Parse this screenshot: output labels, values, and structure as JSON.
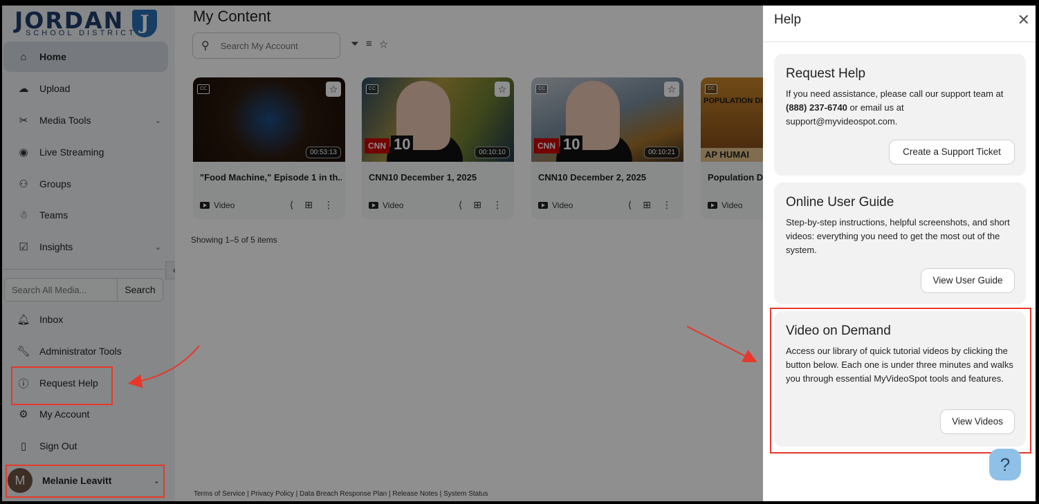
{
  "logo": {
    "wordmark": "JORDAN",
    "subtitle": "SCHOOL DISTRICT",
    "shield_letter": "J"
  },
  "sidebar": {
    "items": [
      {
        "label": "Home",
        "icon": "home-icon",
        "active": true
      },
      {
        "label": "Upload",
        "icon": "upload-icon"
      },
      {
        "label": "Media Tools",
        "icon": "tools-icon",
        "has_chevron": true
      },
      {
        "label": "Live Streaming",
        "icon": "broadcast-icon"
      },
      {
        "label": "Groups",
        "icon": "groups-icon"
      },
      {
        "label": "Teams",
        "icon": "teams-icon"
      },
      {
        "label": "Insights",
        "icon": "insights-icon",
        "has_chevron": true
      }
    ],
    "search_placeholder": "Search All Media...",
    "search_button": "Search",
    "bottom_items": [
      {
        "label": "Inbox",
        "icon": "bell-icon"
      },
      {
        "label": "Administrator Tools",
        "icon": "wrench-icon"
      },
      {
        "label": "Request Help",
        "icon": "info-icon"
      },
      {
        "label": "My Account",
        "icon": "gear-icon"
      },
      {
        "label": "Sign Out",
        "icon": "door-icon"
      }
    ],
    "user": {
      "initial": "M",
      "name": "Melanie Leavitt"
    }
  },
  "main": {
    "title": "My Content",
    "search_placeholder": "Search My Account",
    "cards": [
      {
        "title": "\"Food Machine,\" Episode 1 in th...",
        "duration": "00:53:13",
        "type": "Video"
      },
      {
        "title": "CNN10 December 1, 2025",
        "duration": "00:10:10",
        "type": "Video"
      },
      {
        "title": "CNN10 December 2, 2025",
        "duration": "00:10:21",
        "type": "Video"
      },
      {
        "title": "Population Di",
        "duration": "",
        "type": "Video"
      }
    ],
    "thumb_text": {
      "cnn": "CNN",
      "ten": "10",
      "pop_title": "POPULATION DISTRIBUTION",
      "pop_strip": "AP HUMAI"
    },
    "showing": "Showing 1–5 of 5 items",
    "footer": "Terms of Service | Privacy Policy | Data Breach Response Plan | Release Notes | System Status"
  },
  "help": {
    "title": "Help",
    "sections": [
      {
        "heading": "Request Help",
        "body_pre": "If you need assistance, please call our support team at ",
        "phone": "(888) 237-6740",
        "body_post": " or email us at support@myvideospot.com.",
        "button": "Create a Support Ticket"
      },
      {
        "heading": "Online User Guide",
        "body": "Step-by-step instructions, helpful screenshots, and short videos: everything you need to get the most out of the system.",
        "button": "View User Guide"
      },
      {
        "heading": "Video on Demand",
        "body": "Access our library of quick tutorial videos by clicking the button below. Each one is under three minutes and walks you through essential MyVideoSpot tools and features.",
        "button": "View Videos"
      }
    ],
    "fab": "?"
  },
  "colors": {
    "annotation": "#e8372a",
    "brand": "#1f3d6b",
    "fab": "#8fc1e8"
  }
}
